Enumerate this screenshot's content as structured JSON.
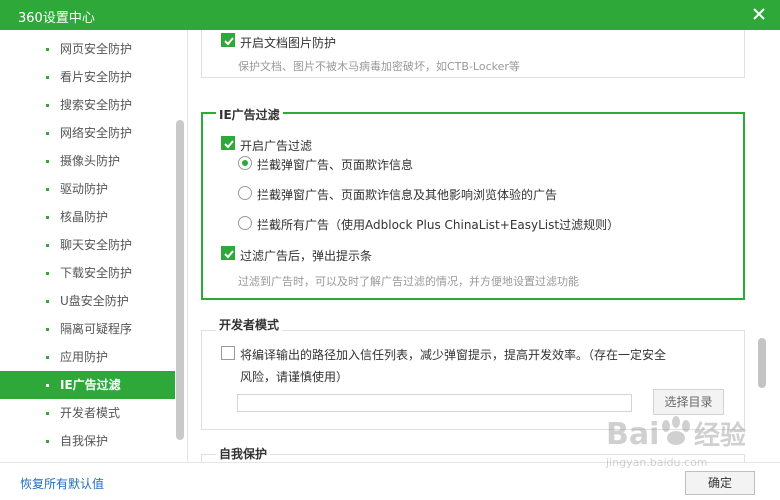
{
  "window": {
    "title": "360设置中心"
  },
  "sidebar": {
    "items": [
      {
        "label": "网页安全防护",
        "active": false
      },
      {
        "label": "看片安全防护",
        "active": false
      },
      {
        "label": "搜索安全防护",
        "active": false
      },
      {
        "label": "网络安全防护",
        "active": false
      },
      {
        "label": "摄像头防护",
        "active": false
      },
      {
        "label": "驱动防护",
        "active": false
      },
      {
        "label": "核晶防护",
        "active": false
      },
      {
        "label": "聊天安全防护",
        "active": false
      },
      {
        "label": "下载安全防护",
        "active": false
      },
      {
        "label": "U盘安全防护",
        "active": false
      },
      {
        "label": "隔离可疑程序",
        "active": false
      },
      {
        "label": "应用防护",
        "active": false
      },
      {
        "label": "IE广告过滤",
        "active": true
      },
      {
        "label": "开发者模式",
        "active": false
      },
      {
        "label": "自我保护",
        "active": false
      }
    ]
  },
  "doc_protect": {
    "checkbox_label": "开启文档图片防护",
    "checked": true,
    "description": "保护文档、图片不被木马病毒加密破坏，如CTB-Locker等"
  },
  "ad_filter": {
    "title": "IE广告过滤",
    "enable_label": "开启广告过滤",
    "enable_checked": true,
    "options": [
      {
        "label": "拦截弹窗广告、页面欺诈信息",
        "selected": true
      },
      {
        "label": "拦截弹窗广告、页面欺诈信息及其他影响浏览体验的广告",
        "selected": false
      },
      {
        "label": "拦截所有广告（使用Adblock Plus ChinaList+EasyList过滤规则）",
        "selected": false
      }
    ],
    "notify_label": "过滤广告后，弹出提示条",
    "notify_checked": true,
    "notify_description": "过滤到广告时，可以及时了解广告过滤的情况，并方便地设置过滤功能"
  },
  "developer_mode": {
    "title": "开发者模式",
    "checkbox_label_line1": "将编译输出的路径加入信任列表，减少弹窗提示，提高开发效率。（存在一定安全",
    "checkbox_label_line2": "风险，请谨慎使用）",
    "checked": false,
    "path_value": "",
    "select_button": "选择目录"
  },
  "self_protect": {
    "title": "自我保护"
  },
  "footer": {
    "restore_label": "恢复所有默认值",
    "ok_label": "确定"
  },
  "watermark": {
    "brand": "Baidu经验",
    "url": "jingyan.baidu.com"
  },
  "colors": {
    "accent": "#2fa83a",
    "link": "#1f6cc0"
  }
}
